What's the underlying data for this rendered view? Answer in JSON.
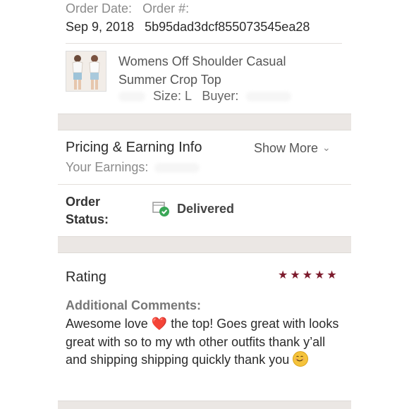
{
  "order": {
    "date_label": "Order Date:",
    "number_label": "Order #:",
    "date_value": "Sep 9, 2018",
    "number_value": "5b95dad3dcf855073545ea28"
  },
  "product": {
    "title": "Womens Off Shoulder Casual Summer Crop Top",
    "size_label": "Size: L",
    "buyer_label": "Buyer:"
  },
  "pricing": {
    "title": "Pricing & Earning Info",
    "show_more_label": "Show More",
    "earnings_label": "Your Earnings:"
  },
  "status": {
    "label_line1": "Order",
    "label_line2": "Status:",
    "value": "Delivered",
    "icon": "delivered-box-check-icon",
    "icon_color": "#3aa757"
  },
  "rating": {
    "title": "Rating",
    "stars": 5,
    "star_color": "#7c1a2c",
    "comments_label": "Additional Comments:",
    "comment_part1": "Awesome love",
    "comment_part2": "the top! Goes great with looks great with so to my wth other outfits thank y’all and shipping shipping quickly thank you",
    "heart": "❤️"
  },
  "colors": {
    "band": "#ebe7e4",
    "accent": "#7c1a2c"
  }
}
